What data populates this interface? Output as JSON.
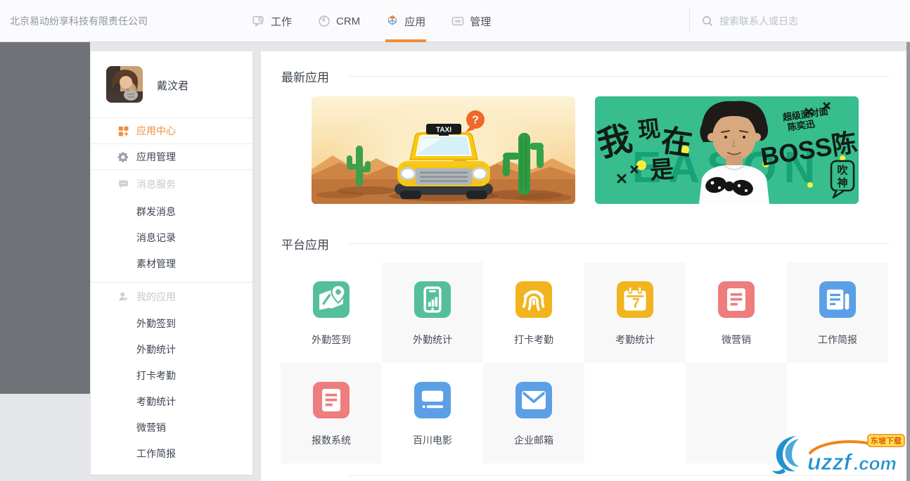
{
  "topbar": {
    "company": "北京易动纷享科技有限责任公司",
    "nav": [
      {
        "label": "工作",
        "icon": "chat-bubble-icon"
      },
      {
        "label": "CRM",
        "icon": "pie-chart-icon"
      },
      {
        "label": "应用",
        "icon": "cube-icon",
        "active": true
      },
      {
        "label": "管理",
        "icon": "admin-card-icon"
      }
    ],
    "search_placeholder": "搜索联系人或日志",
    "accent_color": "#ef8f36"
  },
  "sidebar": {
    "user_name": "戴汶君",
    "items": [
      {
        "label": "应用中心",
        "icon": "app-grid-icon",
        "state": "active"
      },
      {
        "label": "应用管理",
        "icon": "gear-icon",
        "state": "normal"
      },
      {
        "label": "消息服务",
        "icon": "chat-dots-icon",
        "state": "group"
      },
      {
        "label": "群发消息",
        "state": "sub"
      },
      {
        "label": "消息记录",
        "state": "sub"
      },
      {
        "label": "素材管理",
        "state": "sub"
      },
      {
        "label": "我的应用",
        "icon": "person-icon",
        "state": "group"
      },
      {
        "label": "外勤签到",
        "state": "sub"
      },
      {
        "label": "外勤统计",
        "state": "sub"
      },
      {
        "label": "打卡考勤",
        "state": "sub"
      },
      {
        "label": "考勤统计",
        "state": "sub"
      },
      {
        "label": "微营销",
        "state": "sub"
      },
      {
        "label": "工作简报",
        "state": "sub"
      }
    ]
  },
  "main": {
    "section1_title": "最新应用",
    "section2_title": "平台应用",
    "banner_taxi": {
      "sign": "TAXI",
      "question": "?"
    },
    "banner_eason": {
      "hanzi": [
        "我",
        "现",
        "在",
        "是"
      ],
      "bg_text": "EASON",
      "title_small1": "超级面对面",
      "title_small2": "陈奕迅",
      "boss": "BOSS陈",
      "bubble1": "吹",
      "bubble2": "神"
    },
    "colors": {
      "green": "#55bf9c",
      "yellow": "#f1b41e",
      "red": "#ee7d7d",
      "blue": "#5b9fe6"
    },
    "apps": [
      {
        "label": "外勤签到",
        "color": "green",
        "icon": "map-pin-icon"
      },
      {
        "label": "外勤统计",
        "color": "green",
        "icon": "phone-chart-icon"
      },
      {
        "label": "打卡考勤",
        "color": "yellow",
        "icon": "fingerprint-icon"
      },
      {
        "label": "考勤统计",
        "color": "yellow",
        "icon": "calendar-7-icon",
        "calendar_digit": "7"
      },
      {
        "label": "微营销",
        "color": "red",
        "icon": "doc-lines-icon"
      },
      {
        "label": "工作简报",
        "color": "blue",
        "icon": "briefing-icon"
      },
      {
        "label": "报数系统",
        "color": "red",
        "icon": "doc-lines-icon"
      },
      {
        "label": "百川电影",
        "color": "blue",
        "icon": "movie-card-icon"
      },
      {
        "label": "企业邮箱",
        "color": "blue",
        "icon": "mail-icon"
      }
    ]
  },
  "watermark": {
    "site": "uzzf",
    "tld": ".com",
    "badge": "东坡下载"
  }
}
